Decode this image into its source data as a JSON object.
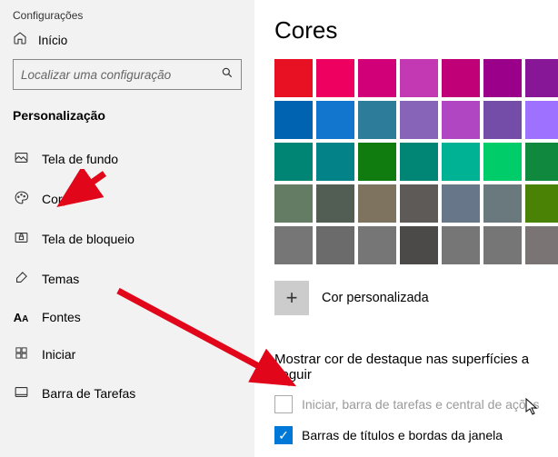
{
  "window_title": "Configurações",
  "home_label": "Início",
  "search_placeholder": "Localizar uma configuração",
  "section_title": "Personalização",
  "nav_items": [
    {
      "icon": "image",
      "label": "Tela de fundo"
    },
    {
      "icon": "palette",
      "label": "Cores"
    },
    {
      "icon": "lock",
      "label": "Tela de bloqueio"
    },
    {
      "icon": "brush",
      "label": "Temas"
    },
    {
      "icon": "font",
      "label": "Fontes"
    },
    {
      "icon": "start",
      "label": "Iniciar"
    },
    {
      "icon": "taskbar",
      "label": "Barra de Tarefas"
    }
  ],
  "main_heading": "Cores",
  "color_swatches": [
    "#e81123",
    "#ed0060",
    "#d10078",
    "#c239b3",
    "#bf0077",
    "#9a0089",
    "#881798",
    "#0063b1",
    "#1275ce",
    "#2d7d9a",
    "#8764b8",
    "#b146c2",
    "#744da9",
    "#9e72ff",
    "#008575",
    "#038387",
    "#107c10",
    "#018574",
    "#00b294",
    "#00cc6a",
    "#10893e",
    "#647c64",
    "#525e54",
    "#7e735f",
    "#5d5a58",
    "#68768a",
    "#69797e",
    "#4a8205",
    "#767676",
    "#6b6b6b",
    "#767676",
    "#4c4a48",
    "#767676",
    "#767676",
    "#7a7574"
  ],
  "custom_color_label": "Cor personalizada",
  "surfaces_heading": "Mostrar cor de destaque nas superfícies a seguir",
  "checkbox_start_label": "Iniciar, barra de tarefas e central de ações",
  "checkbox_titlebar_label": "Barras de títulos e bordas da janela"
}
